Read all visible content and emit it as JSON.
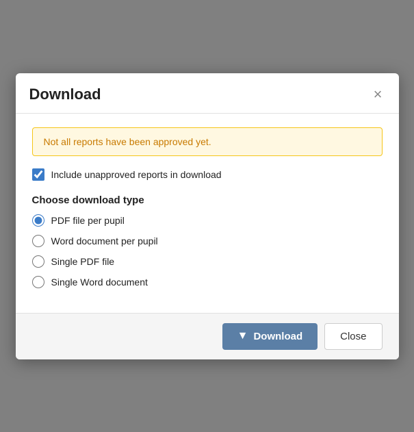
{
  "modal": {
    "title": "Download",
    "close_label": "×",
    "warning": {
      "text": "Not all reports have been approved yet."
    },
    "checkbox": {
      "label": "Include unapproved reports in download",
      "checked": true
    },
    "download_type": {
      "section_label": "Choose download type",
      "options": [
        {
          "id": "pdf-per-pupil",
          "label": "PDF file per pupil",
          "checked": true
        },
        {
          "id": "word-per-pupil",
          "label": "Word document per pupil",
          "checked": false
        },
        {
          "id": "single-pdf",
          "label": "Single PDF file",
          "checked": false
        },
        {
          "id": "single-word",
          "label": "Single Word document",
          "checked": false
        }
      ]
    },
    "footer": {
      "download_button": "Download",
      "close_button": "Close"
    }
  }
}
